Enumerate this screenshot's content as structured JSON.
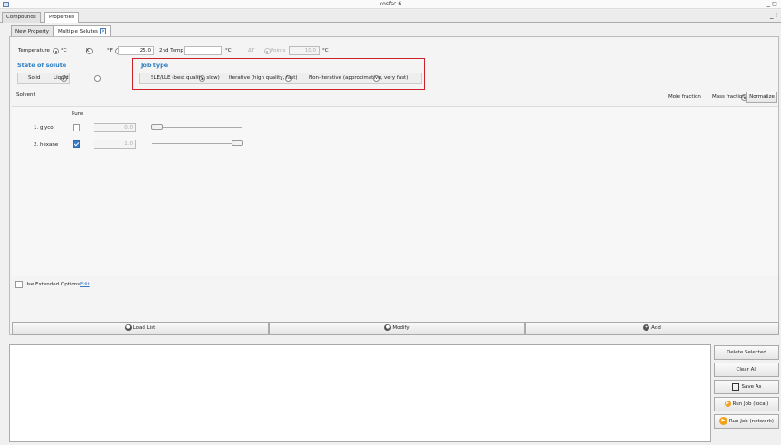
{
  "window": {
    "title": "cosfsc 6",
    "controls": "_ ◻"
  },
  "main_tabs": [
    {
      "label": "Compounds",
      "active": false
    },
    {
      "label": "Properties",
      "active": true
    }
  ],
  "sub_tabs": [
    {
      "label": "New Property",
      "active": false
    },
    {
      "label": "Multiple Solutes",
      "active": true,
      "close": "✕"
    }
  ],
  "temperature": {
    "label": "Temperature",
    "units": [
      "°C",
      "K",
      "°F"
    ],
    "selected_unit": "°C",
    "value": "25.0",
    "second_label": "2nd Temp",
    "second_value": "",
    "second_unit": "°C",
    "mode_options": [
      "ΔT",
      "Points"
    ],
    "range_value": "10.0",
    "range_unit": "°C"
  },
  "state_of_solute": {
    "title": "State of solute",
    "options": [
      "Solid",
      "Liquid"
    ]
  },
  "job_type": {
    "title": "Job type",
    "options": [
      "SLE/LLE (best quality, slow)",
      "Iterative (high quality, fast)",
      "Non-Iterative (approximative, very fast)"
    ]
  },
  "solvent": {
    "label": "Solvent",
    "fraction_options": [
      "Mole fraction",
      "Mass fraction"
    ],
    "normalize_label": "Normalize",
    "pure_header": "Pure",
    "rows": [
      {
        "name": "1.  glycol",
        "pure": false,
        "value": "0.0"
      },
      {
        "name": "2.  hexane",
        "pure": true,
        "value": "1.0"
      }
    ]
  },
  "extended": {
    "label": "Use Extended Options",
    "edit": "Edit"
  },
  "actions": {
    "load": "Load List",
    "modify": "Modify",
    "add": "Add"
  },
  "side_buttons": {
    "delete": "Delete Selected",
    "clear": "Clear All",
    "save": "Save As",
    "run_local": "Run Job (local)",
    "run_network": "Run Job (network)"
  },
  "colors": {
    "accent": "#2f7fc4",
    "highlight": "#cc2229",
    "run_icon": "#f2a01a"
  }
}
